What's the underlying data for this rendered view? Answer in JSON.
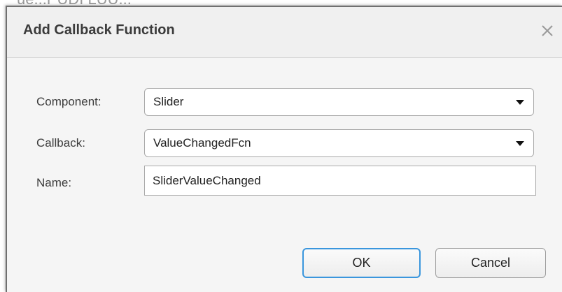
{
  "background": {
    "partial_text": "ue...PUDI LUU..."
  },
  "dialog": {
    "title": "Add Callback Function",
    "close_icon": "close-icon",
    "fields": {
      "component": {
        "label": "Component:",
        "value": "Slider"
      },
      "callback": {
        "label": "Callback:",
        "value": "ValueChangedFcn"
      },
      "name": {
        "label": "Name:",
        "value": "SliderValueChanged"
      }
    },
    "buttons": {
      "ok_label": "OK",
      "cancel_label": "Cancel"
    }
  },
  "colors": {
    "accent_focus": "#3a96dd",
    "dialog_bg": "#f5f5f5",
    "title_text": "#3b3b3b"
  }
}
